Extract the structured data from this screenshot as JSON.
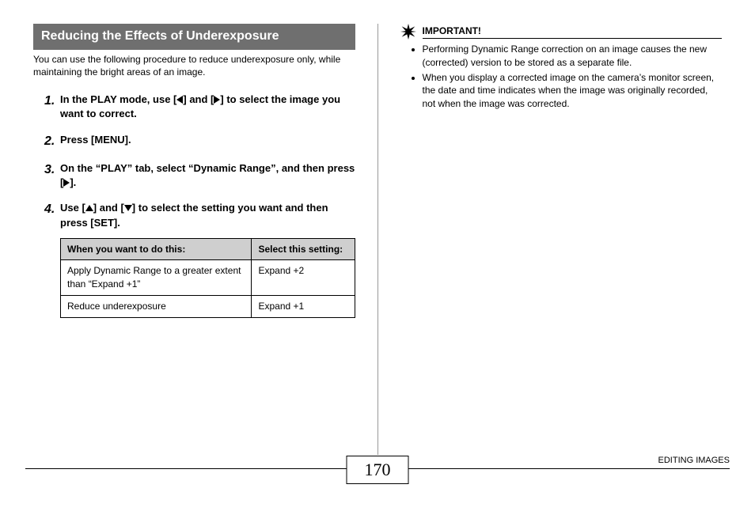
{
  "left": {
    "section_title": "Reducing the Effects of Underexposure",
    "intro": "You can use the following procedure to reduce underexposure only, while maintaining the bright areas of an image.",
    "steps": {
      "s1": {
        "num": "1.",
        "a": "In the PLAY mode, use [",
        "b": "] and [",
        "c": "] to select the image you want to correct."
      },
      "s2": {
        "num": "2.",
        "text": "Press [MENU]."
      },
      "s3": {
        "num": "3.",
        "a": "On the “PLAY” tab, select “Dynamic Range”, and then press [",
        "b": "]."
      },
      "s4": {
        "num": "4.",
        "a": "Use [",
        "b": "] and [",
        "c": "] to select the setting you want and then press [SET]."
      }
    },
    "table": {
      "head_left": "When you want to do this:",
      "head_right": "Select this setting:",
      "rows": [
        {
          "do": "Apply Dynamic Range to a greater extent than “Expand +1”",
          "setting": "Expand +2"
        },
        {
          "do": "Reduce underexposure",
          "setting": "Expand +1"
        }
      ]
    }
  },
  "right": {
    "important_label": "IMPORTANT!",
    "notes": [
      "Performing Dynamic Range correction on an image causes the new (corrected) version to be stored as a separate file.",
      "When you display a corrected image on the camera’s monitor screen, the date and time indicates when the image was originally recorded, not when the image was corrected."
    ]
  },
  "footer": {
    "page": "170",
    "chapter": "EDITING IMAGES"
  }
}
